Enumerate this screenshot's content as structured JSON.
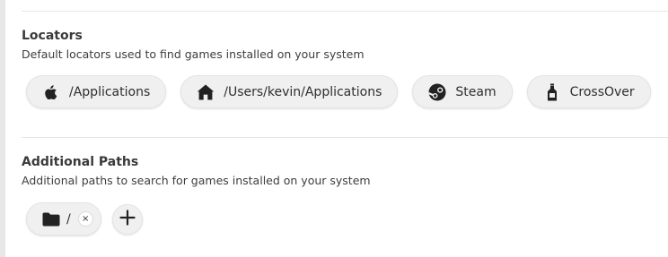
{
  "locators": {
    "title": "Locators",
    "subtitle": "Default locators used to find games installed on your system",
    "items": [
      {
        "label": "/Applications",
        "icon": "apple-icon"
      },
      {
        "label": "/Users/kevin/Applications",
        "icon": "home-icon"
      },
      {
        "label": "Steam",
        "icon": "steam-icon"
      },
      {
        "label": "CrossOver",
        "icon": "bottle-icon"
      }
    ]
  },
  "additional_paths": {
    "title": "Additional Paths",
    "subtitle": "Additional paths to search for games installed on your system",
    "items": [
      {
        "label": "/",
        "icon": "folder-icon",
        "remove_glyph": "×"
      }
    ],
    "add_icon": "plus-icon"
  },
  "colors": {
    "chip_bg": "#f0f0f0",
    "text": "#2e2e2e",
    "divider": "#e6e6e6"
  }
}
